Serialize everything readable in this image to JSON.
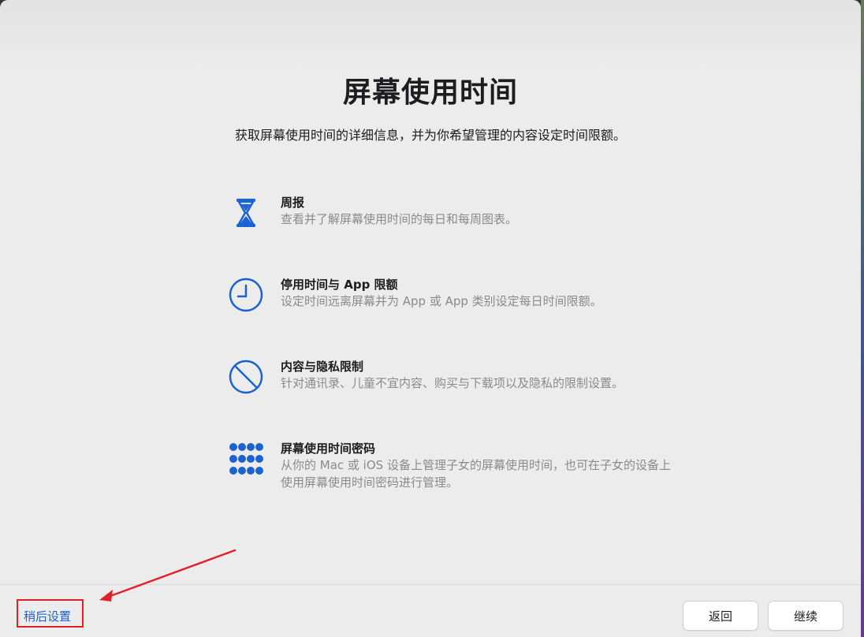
{
  "page": {
    "title": "屏幕使用时间",
    "subtitle": "获取屏幕使用时间的详细信息，并为你希望管理的内容设定时间限额。"
  },
  "features": [
    {
      "icon": "hourglass-icon",
      "title": "周报",
      "desc": "查看并了解屏幕使用时间的每日和每周图表。"
    },
    {
      "icon": "clock-icon",
      "title": "停用时间与 App 限额",
      "desc": "设定时间远离屏幕并为 App 或 App 类别设定每日时间限额。"
    },
    {
      "icon": "prohibited-icon",
      "title": "内容与隐私限制",
      "desc": "针对通讯录、儿童不宜内容、购买与下载项以及隐私的限制设置。"
    },
    {
      "icon": "passcode-grid-icon",
      "title": "屏幕使用时间密码",
      "desc": "从你的 Mac 或 iOS 设备上管理子女的屏幕使用时间，也可在子女的设备上使用屏幕使用时间密码进行管理。"
    }
  ],
  "footer": {
    "later_label": "稍后设置",
    "back_label": "返回",
    "continue_label": "继续"
  },
  "colors": {
    "accent": "#1a63d1",
    "annotation": "#e0212b"
  }
}
